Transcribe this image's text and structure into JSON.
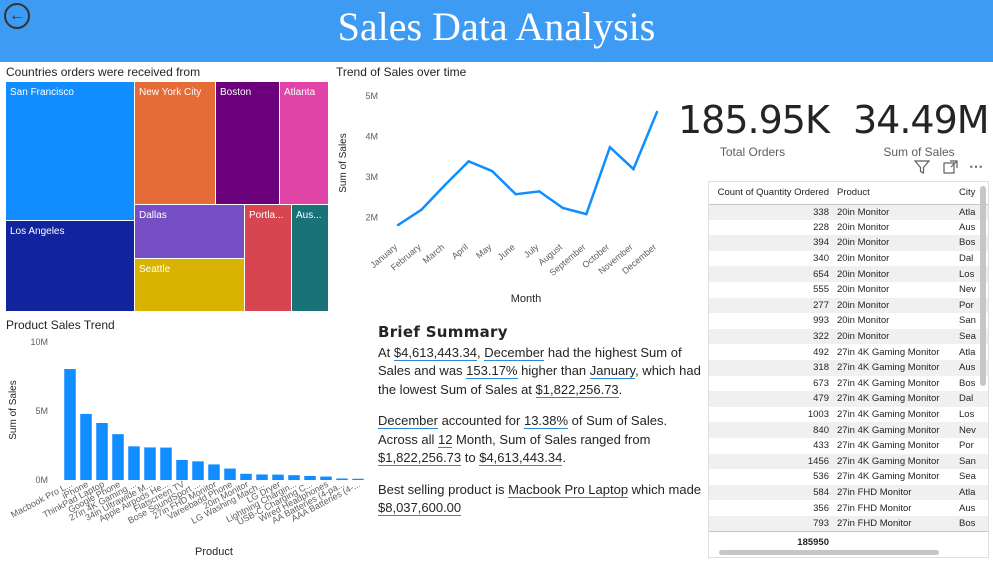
{
  "header": {
    "title": "Sales Data Analysis",
    "back_icon": "back-arrow-icon"
  },
  "treemap": {
    "title": "Countries orders were received from",
    "cells": [
      {
        "label": "San Francisco",
        "color": "#118dff"
      },
      {
        "label": "Los Angeles",
        "color": "#12239e"
      },
      {
        "label": "New York City",
        "color": "#e66c37"
      },
      {
        "label": "Boston",
        "color": "#6b007b"
      },
      {
        "label": "Atlanta",
        "color": "#e044a7"
      },
      {
        "label": "Dallas",
        "color": "#744ec2"
      },
      {
        "label": "Seattle",
        "color": "#d9b300"
      },
      {
        "label": "Portla...",
        "color": "#d64550"
      },
      {
        "label": "Aus...",
        "color": "#197278"
      }
    ]
  },
  "line_chart": {
    "title": "Trend of Sales over time",
    "xlabel": "Month",
    "ylabel": "Sum of Sales",
    "color": "#118dff",
    "chart_data": {
      "type": "line",
      "x": [
        "January",
        "February",
        "March",
        "April",
        "May",
        "June",
        "July",
        "August",
        "September",
        "October",
        "November",
        "December"
      ],
      "values": [
        1.82,
        2.2,
        2.81,
        3.39,
        3.15,
        2.58,
        2.65,
        2.24,
        2.09,
        3.74,
        3.2,
        4.61
      ],
      "yticks": [
        "2M",
        "3M",
        "4M",
        "5M"
      ],
      "ylim": [
        1.5,
        5.2
      ],
      "grid": false
    }
  },
  "bar_chart": {
    "title": "Product Sales Trend",
    "xlabel": "Product",
    "ylabel": "Sum of Sales",
    "color": "#118dff",
    "chart_data": {
      "type": "bar",
      "categories": [
        "Macbook Pro L...",
        "iPhone",
        "ThinkPad Laptop",
        "Google Phone",
        "27in 4K Gaming ...",
        "34in Ultrawide M...",
        "Apple Airpods He...",
        "Flatscreen TV",
        "Bose SoundSport ...",
        "27in FHD Monitor",
        "Vareebadd Phone",
        "20in Monitor",
        "LG Washing Mach...",
        "LG Dryer",
        "Lightning Chargin...",
        "USB-C Charging C...",
        "Wired Headphones",
        "AA Batteries (4-pa...",
        "AAA Batteries (4-..."
      ],
      "values": [
        8.04,
        4.79,
        4.13,
        3.32,
        2.44,
        2.36,
        2.35,
        1.45,
        1.35,
        1.13,
        0.83,
        0.45,
        0.4,
        0.39,
        0.35,
        0.29,
        0.25,
        0.11,
        0.09
      ],
      "yticks": [
        "0M",
        "5M",
        "10M"
      ],
      "ylim": [
        0,
        10
      ],
      "grid": false
    }
  },
  "kpis": [
    {
      "value": "185.95K",
      "label": "Total Orders"
    },
    {
      "value": "34.49M",
      "label": "Sum of Sales"
    }
  ],
  "visual_icons": {
    "filter": "filter-icon",
    "focus": "focus-mode-icon",
    "more": "more-options-icon"
  },
  "summary": {
    "heading": "Brief Summary",
    "p1": [
      "At ",
      "$4,613,443.34",
      ", ",
      "December",
      " had the highest Sum of Sales and was ",
      "153.17%",
      " higher than ",
      "January",
      ", which had the lowest Sum of Sales at ",
      "$1,822,256.73",
      "."
    ],
    "p2": [
      "December",
      " accounted for ",
      "13.38%",
      " of Sum of Sales. Across all ",
      "12",
      " Month, Sum of Sales ranged from ",
      "$1,822,256.73",
      " to ",
      "$4,613,443.34",
      "."
    ],
    "p3": [
      "Best selling product is ",
      "Macbook Pro Laptop",
      " which made ",
      "$8,037,600.00"
    ]
  },
  "table": {
    "headers": [
      "Count of Quantity Ordered",
      "Product",
      "City"
    ],
    "rows": [
      [
        "338",
        "20in Monitor",
        "Atla"
      ],
      [
        "228",
        "20in Monitor",
        "Aus"
      ],
      [
        "394",
        "20in Monitor",
        "Bos"
      ],
      [
        "340",
        "20in Monitor",
        "Dal"
      ],
      [
        "654",
        "20in Monitor",
        "Los"
      ],
      [
        "555",
        "20in Monitor",
        "Nev"
      ],
      [
        "277",
        "20in Monitor",
        "Por"
      ],
      [
        "993",
        "20in Monitor",
        "San"
      ],
      [
        "322",
        "20in Monitor",
        "Sea"
      ],
      [
        "492",
        "27in 4K Gaming Monitor",
        "Atla"
      ],
      [
        "318",
        "27in 4K Gaming Monitor",
        "Aus"
      ],
      [
        "673",
        "27in 4K Gaming Monitor",
        "Bos"
      ],
      [
        "479",
        "27in 4K Gaming Monitor",
        "Dal"
      ],
      [
        "1003",
        "27in 4K Gaming Monitor",
        "Los"
      ],
      [
        "840",
        "27in 4K Gaming Monitor",
        "Nev"
      ],
      [
        "433",
        "27in 4K Gaming Monitor",
        "Por"
      ],
      [
        "1456",
        "27in 4K Gaming Monitor",
        "San"
      ],
      [
        "536",
        "27in 4K Gaming Monitor",
        "Sea"
      ],
      [
        "584",
        "27in FHD Monitor",
        "Atla"
      ],
      [
        "356",
        "27in FHD Monitor",
        "Aus"
      ],
      [
        "793",
        "27in FHD Monitor",
        "Bos"
      ]
    ],
    "total": "185950"
  }
}
